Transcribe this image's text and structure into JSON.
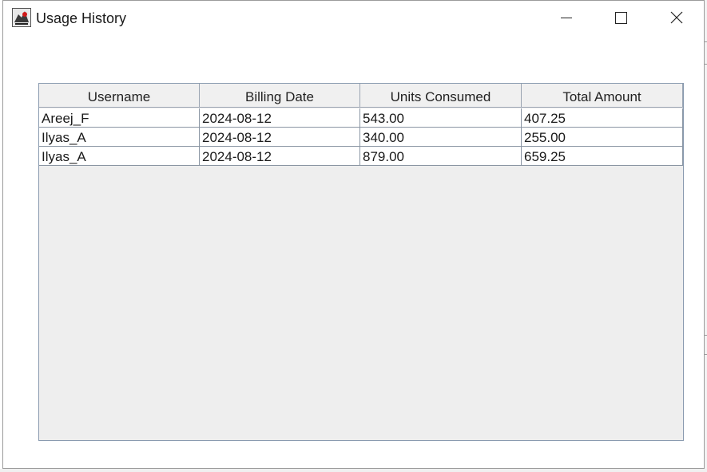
{
  "window": {
    "title": "Usage History",
    "controls": [
      "minimize-icon",
      "maximize-icon",
      "close-icon"
    ]
  },
  "table": {
    "columns": [
      "Username",
      "Billing Date",
      "Units Consumed",
      "Total Amount"
    ],
    "rows": [
      [
        "Areej_F",
        "2024-08-12",
        "543.00",
        "407.25"
      ],
      [
        "Ilyas_A",
        "2024-08-12",
        "340.00",
        "255.00"
      ],
      [
        "Ilyas_A",
        "2024-08-12",
        "879.00",
        "659.25"
      ]
    ]
  }
}
